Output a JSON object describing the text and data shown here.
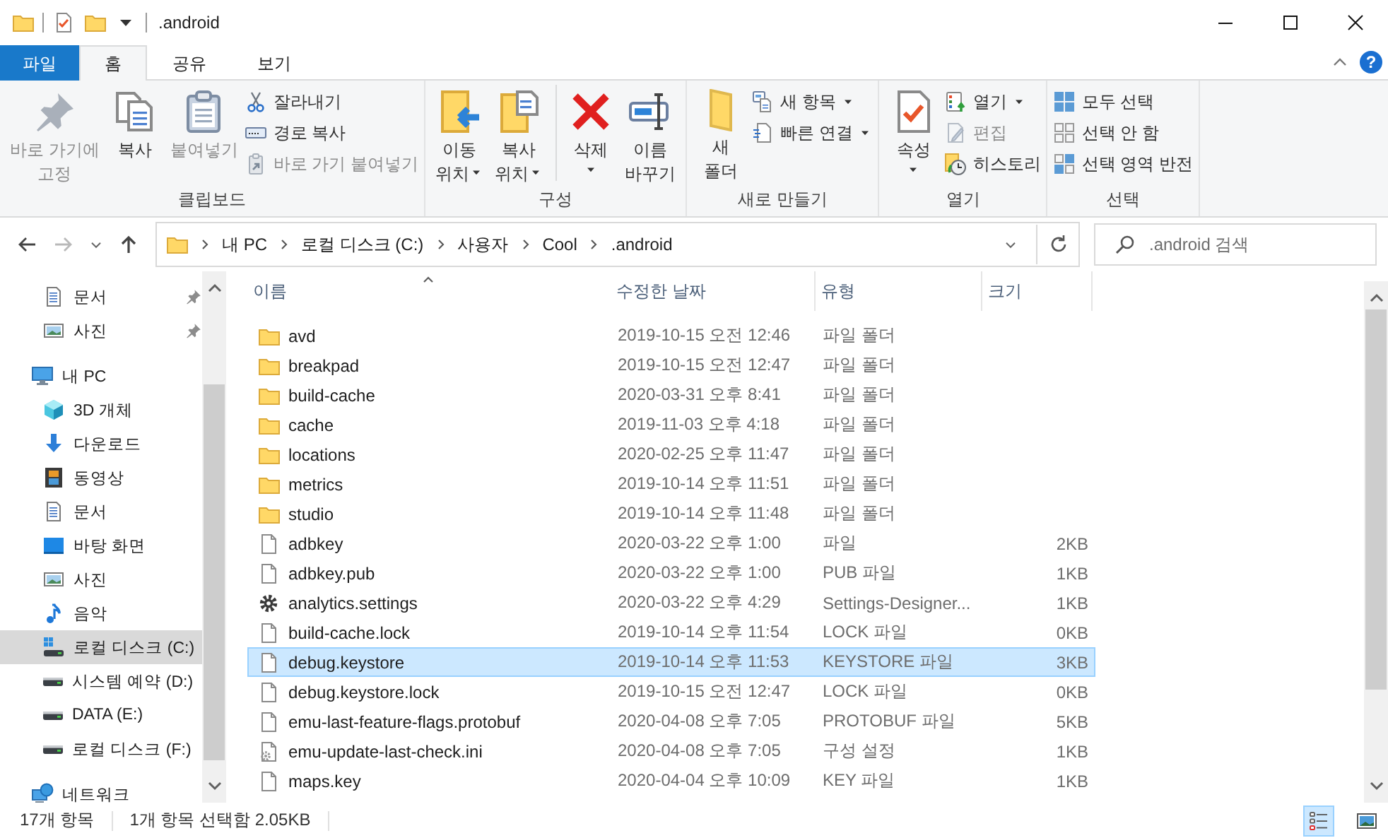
{
  "window": {
    "title": ".android"
  },
  "ribbon_tabs": [
    {
      "label": "파일",
      "kind": "file",
      "selected": false
    },
    {
      "label": "홈",
      "kind": "tab",
      "selected": true
    },
    {
      "label": "공유",
      "kind": "tab",
      "selected": false
    },
    {
      "label": "보기",
      "kind": "tab",
      "selected": false
    }
  ],
  "help_button": {
    "label": "?"
  },
  "ribbon": {
    "groups": [
      {
        "label": "클립보드",
        "items": [
          {
            "kind": "large",
            "lines": [
              "바로 가기에",
              "고정"
            ],
            "disabled": true,
            "dropdown": false,
            "separator_before": false
          },
          {
            "kind": "large",
            "lines": [
              "복사"
            ],
            "disabled": false,
            "dropdown": false,
            "separator_before": false
          },
          {
            "kind": "large",
            "lines": [
              "붙여넣기"
            ],
            "disabled": true,
            "dropdown": false,
            "separator_before": false
          },
          {
            "kind": "small",
            "lines": [
              "잘라내기"
            ],
            "disabled": false,
            "dropdown": false,
            "separator_before": false
          },
          {
            "kind": "small",
            "lines": [
              "경로 복사"
            ],
            "disabled": false,
            "dropdown": false,
            "separator_before": false
          },
          {
            "kind": "small",
            "lines": [
              "바로 가기 붙여넣기"
            ],
            "disabled": true,
            "dropdown": false,
            "separator_before": false
          }
        ]
      },
      {
        "label": "구성",
        "items": [
          {
            "kind": "large",
            "lines": [
              "이동",
              "위치"
            ],
            "disabled": false,
            "dropdown": true,
            "separator_before": false
          },
          {
            "kind": "large",
            "lines": [
              "복사",
              "위치"
            ],
            "disabled": false,
            "dropdown": true,
            "separator_before": false
          },
          {
            "kind": "large",
            "lines": [
              "삭제"
            ],
            "disabled": false,
            "dropdown": true,
            "separator_before": true
          },
          {
            "kind": "large",
            "lines": [
              "이름",
              "바꾸기"
            ],
            "disabled": false,
            "dropdown": false,
            "separator_before": false
          }
        ]
      },
      {
        "label": "새로 만들기",
        "items": [
          {
            "kind": "large",
            "lines": [
              "새",
              "폴더"
            ],
            "disabled": false,
            "dropdown": false,
            "separator_before": false
          },
          {
            "kind": "small",
            "lines": [
              "새 항목"
            ],
            "disabled": false,
            "dropdown": true,
            "separator_before": false
          },
          {
            "kind": "small",
            "lines": [
              "빠른 연결"
            ],
            "disabled": false,
            "dropdown": true,
            "separator_before": false
          }
        ]
      },
      {
        "label": "열기",
        "items": [
          {
            "kind": "large",
            "lines": [
              "속성"
            ],
            "disabled": false,
            "dropdown": true,
            "separator_before": false
          },
          {
            "kind": "small",
            "lines": [
              "열기"
            ],
            "disabled": false,
            "dropdown": true,
            "separator_before": false
          },
          {
            "kind": "small",
            "lines": [
              "편집"
            ],
            "disabled": true,
            "dropdown": false,
            "separator_before": false
          },
          {
            "kind": "small",
            "lines": [
              "히스토리"
            ],
            "disabled": false,
            "dropdown": false,
            "separator_before": false
          }
        ]
      },
      {
        "label": "선택",
        "items": [
          {
            "kind": "small",
            "lines": [
              "모두 선택"
            ],
            "disabled": false,
            "dropdown": false,
            "separator_before": false
          },
          {
            "kind": "small",
            "lines": [
              "선택 안 함"
            ],
            "disabled": false,
            "dropdown": false,
            "separator_before": false
          },
          {
            "kind": "small",
            "lines": [
              "선택 영역 반전"
            ],
            "disabled": false,
            "dropdown": false,
            "separator_before": false
          }
        ]
      }
    ]
  },
  "address_bar": {
    "crumbs": [
      "내 PC",
      "로컬 디스크 (C:)",
      "사용자",
      "Cool",
      ".android"
    ]
  },
  "search": {
    "placeholder": ".android 검색"
  },
  "sidebar": {
    "quick_access": [
      {
        "label": "문서",
        "kind": "document",
        "pinned": true,
        "selected": false
      },
      {
        "label": "사진",
        "kind": "picture",
        "pinned": true,
        "selected": false
      }
    ],
    "tree": [
      {
        "label": "내 PC",
        "kind": "pc",
        "selected": false,
        "children": [
          {
            "label": "3D 개체",
            "kind": "cube",
            "selected": false
          },
          {
            "label": "다운로드",
            "kind": "download",
            "selected": false
          },
          {
            "label": "동영상",
            "kind": "video",
            "selected": false
          },
          {
            "label": "문서",
            "kind": "document",
            "selected": false
          },
          {
            "label": "바탕 화면",
            "kind": "desktop",
            "selected": false
          },
          {
            "label": "사진",
            "kind": "picture",
            "selected": false
          },
          {
            "label": "음악",
            "kind": "music",
            "selected": false
          },
          {
            "label": "로컬 디스크 (C:)",
            "kind": "system_drive",
            "selected": true
          },
          {
            "label": "시스템 예약 (D:)",
            "kind": "drive",
            "selected": false
          },
          {
            "label": "DATA (E:)",
            "kind": "drive",
            "selected": false
          },
          {
            "label": "로컬 디스크 (F:)",
            "kind": "drive",
            "selected": false
          }
        ]
      },
      {
        "label": "네트워크",
        "kind": "network",
        "selected": false
      }
    ]
  },
  "table": {
    "columns": [
      {
        "label": "이름",
        "sorted": true
      },
      {
        "label": "수정한 날짜",
        "sorted": false
      },
      {
        "label": "유형",
        "sorted": false
      },
      {
        "label": "크기",
        "sorted": false
      }
    ],
    "rows": [
      {
        "name": "avd",
        "date": "2019-10-15 오전 12:46",
        "type": "파일 폴더",
        "kind": "folder",
        "selected": false
      },
      {
        "name": "breakpad",
        "date": "2019-10-15 오전 12:47",
        "type": "파일 폴더",
        "kind": "folder",
        "selected": false
      },
      {
        "name": "build-cache",
        "date": "2020-03-31 오후 8:41",
        "type": "파일 폴더",
        "kind": "folder",
        "selected": false
      },
      {
        "name": "cache",
        "date": "2019-11-03 오후 4:18",
        "type": "파일 폴더",
        "kind": "folder",
        "selected": false
      },
      {
        "name": "locations",
        "date": "2020-02-25 오후 11:47",
        "type": "파일 폴더",
        "kind": "folder",
        "selected": false
      },
      {
        "name": "metrics",
        "date": "2019-10-14 오후 11:51",
        "type": "파일 폴더",
        "kind": "folder",
        "selected": false
      },
      {
        "name": "studio",
        "date": "2019-10-14 오후 11:48",
        "type": "파일 폴더",
        "kind": "folder",
        "selected": false
      },
      {
        "name": "adbkey",
        "date": "2020-03-22 오후 1:00",
        "type": "파일",
        "size": "2KB",
        "kind": "file",
        "selected": false
      },
      {
        "name": "adbkey.pub",
        "date": "2020-03-22 오후 1:00",
        "type": "PUB 파일",
        "size": "1KB",
        "kind": "file",
        "selected": false
      },
      {
        "name": "analytics.settings",
        "date": "2020-03-22 오후 4:29",
        "type": "Settings-Designer...",
        "size": "1KB",
        "kind": "settings",
        "selected": false
      },
      {
        "name": "build-cache.lock",
        "date": "2019-10-14 오후 11:54",
        "type": "LOCK 파일",
        "size": "0KB",
        "kind": "file",
        "selected": false
      },
      {
        "name": "debug.keystore",
        "date": "2019-10-14 오후 11:53",
        "type": "KEYSTORE 파일",
        "size": "3KB",
        "kind": "file",
        "selected": true
      },
      {
        "name": "debug.keystore.lock",
        "date": "2019-10-15 오전 12:47",
        "type": "LOCK 파일",
        "size": "0KB",
        "kind": "file",
        "selected": false
      },
      {
        "name": "emu-last-feature-flags.protobuf",
        "date": "2020-04-08 오후 7:05",
        "type": "PROTOBUF 파일",
        "size": "5KB",
        "kind": "file",
        "selected": false
      },
      {
        "name": "emu-update-last-check.ini",
        "date": "2020-04-08 오후 7:05",
        "type": "구성 설정",
        "size": "1KB",
        "kind": "config",
        "selected": false
      },
      {
        "name": "maps.key",
        "date": "2020-04-04 오후 10:09",
        "type": "KEY 파일",
        "size": "1KB",
        "kind": "file",
        "selected": false
      }
    ]
  },
  "status_bar": {
    "item_count": "17개 항목",
    "selection": "1개 항목 선택함 2.05KB"
  },
  "view_buttons": [
    {
      "kind": "details",
      "selected": true
    },
    {
      "kind": "large_icons",
      "selected": false
    }
  ]
}
